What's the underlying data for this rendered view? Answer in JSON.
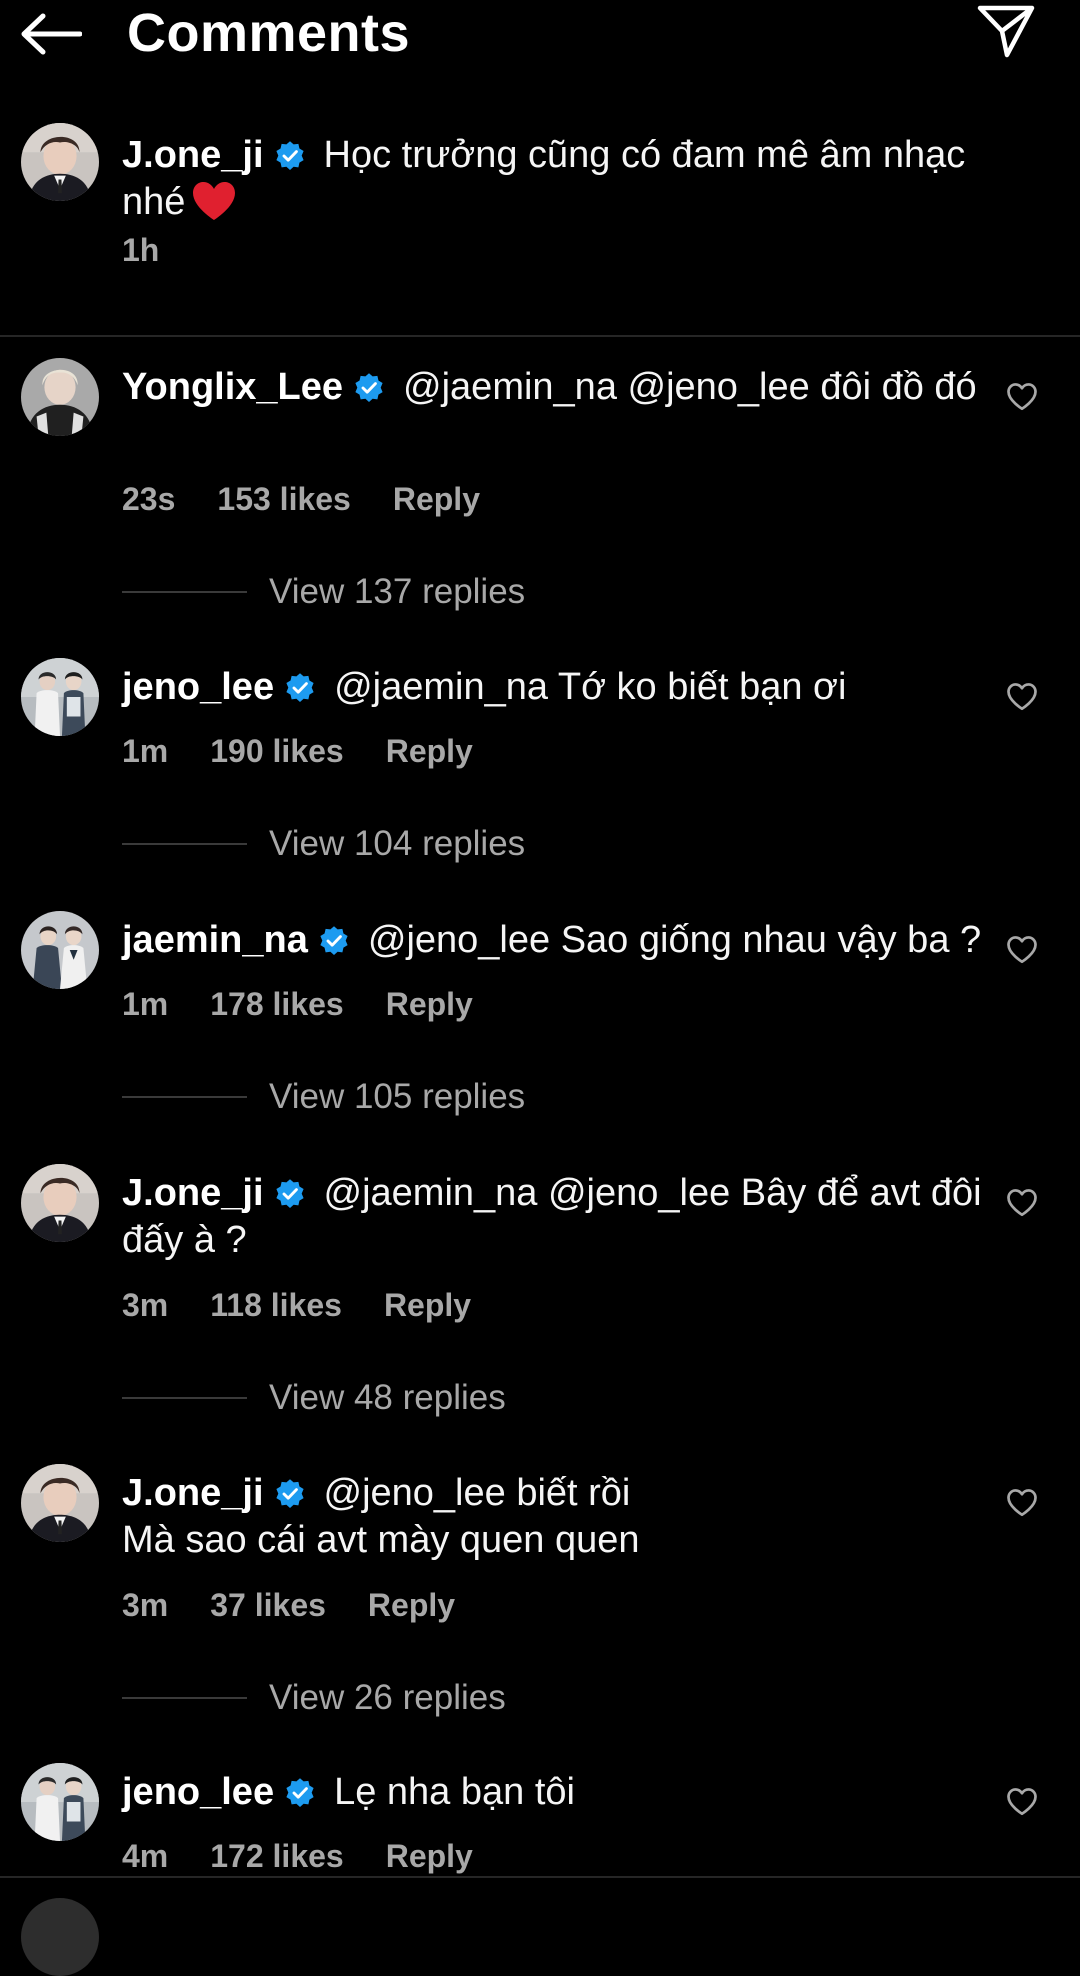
{
  "header": {
    "title": "Comments"
  },
  "caption": {
    "username": "J.one_ji",
    "text": "Học trưởng cũng có đam mê âm nhạc nhé",
    "emoji": "heart-emoji",
    "time": "1h"
  },
  "comments": [
    {
      "username": "Yonglix_Lee",
      "text": "@jaemin_na @jeno_lee đôi đồ đó",
      "time": "23s",
      "likes": "153 likes",
      "reply": "Reply",
      "view_replies": "View 137 replies"
    },
    {
      "username": "jeno_lee",
      "text": "@jaemin_na Tớ ko biết bạn ơi",
      "time": "1m",
      "likes": "190 likes",
      "reply": "Reply",
      "view_replies": "View 104 replies"
    },
    {
      "username": "jaemin_na",
      "text": "@jeno_lee Sao giống nhau vậy ba ?",
      "time": "1m",
      "likes": "178 likes",
      "reply": "Reply",
      "view_replies": "View 105 replies"
    },
    {
      "username": "J.one_ji",
      "text": "@jaemin_na @jeno_lee Bây để avt đôi đấy à ?",
      "time": "3m",
      "likes": "118 likes",
      "reply": "Reply",
      "view_replies": "View 48 replies"
    },
    {
      "username": "J.one_ji",
      "text": "@jeno_lee biết rồi",
      "text_line2": "Mà sao cái avt mày quen quen",
      "time": "3m",
      "likes": "37 likes",
      "reply": "Reply",
      "view_replies": "View 26 replies"
    },
    {
      "username": "jeno_lee",
      "text": "Lẹ nha bạn tôi",
      "time": "4m",
      "likes": "172 likes",
      "reply": "Reply"
    }
  ],
  "colors": {
    "background": "#000000",
    "text": "#ffffff",
    "secondary": "#a8a8a8",
    "verified": "#1d9bf0",
    "heart_emoji": "#e0202f"
  },
  "icons": {
    "back": "back-arrow-icon",
    "send": "send-icon",
    "like": "heart-outline-icon",
    "verified": "verified-badge-icon"
  }
}
